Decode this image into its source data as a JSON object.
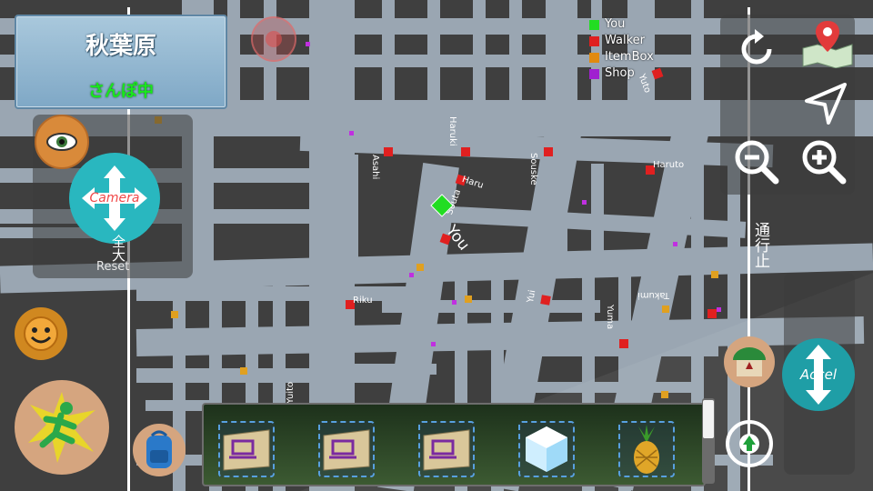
{
  "area": {
    "name": "秋葉原",
    "status": "さんぽ中"
  },
  "legend": [
    {
      "label": "You",
      "color": "#22dd22"
    },
    {
      "label": "Walker",
      "color": "#e02020"
    },
    {
      "label": "ItemBox",
      "color": "#e08a10"
    },
    {
      "label": "Shop",
      "color": "#a020d0"
    }
  ],
  "map_labels": {
    "you": "You",
    "walkers": [
      "Asahi",
      "Haruki",
      "Souske",
      "Haruto",
      "Haru",
      "Souta",
      "Riku",
      "Yui",
      "Yuma",
      "Takumi",
      "Yuito",
      "Yuto"
    ]
  },
  "controls": {
    "camera_label": "Camera",
    "reset_label": "Reset",
    "zoom_out_vertical": "全大",
    "traffic_stop_vertical": "通行止",
    "accel_label": "Accel",
    "hud_icons": [
      "refresh-icon",
      "map-pin-icon",
      "navigate-arrow-icon",
      "zoom-out-icon",
      "zoom-in-icon",
      "eye-icon",
      "smile-face-icon",
      "running-man-icon",
      "backpack-icon",
      "location-up-icon"
    ]
  },
  "colors": {
    "road": "#9aa6b2",
    "block": "#3f3f3f",
    "area_panel": "#8fb5d2",
    "status_green": "#19e81c",
    "teal_button": "#29b7bf"
  },
  "inventory": {
    "items": [
      {
        "name": "laptop-box-item"
      },
      {
        "name": "laptop-box-item"
      },
      {
        "name": "laptop-box-item"
      },
      {
        "name": "ice-cube-item"
      },
      {
        "name": "pineapple-item"
      }
    ]
  }
}
